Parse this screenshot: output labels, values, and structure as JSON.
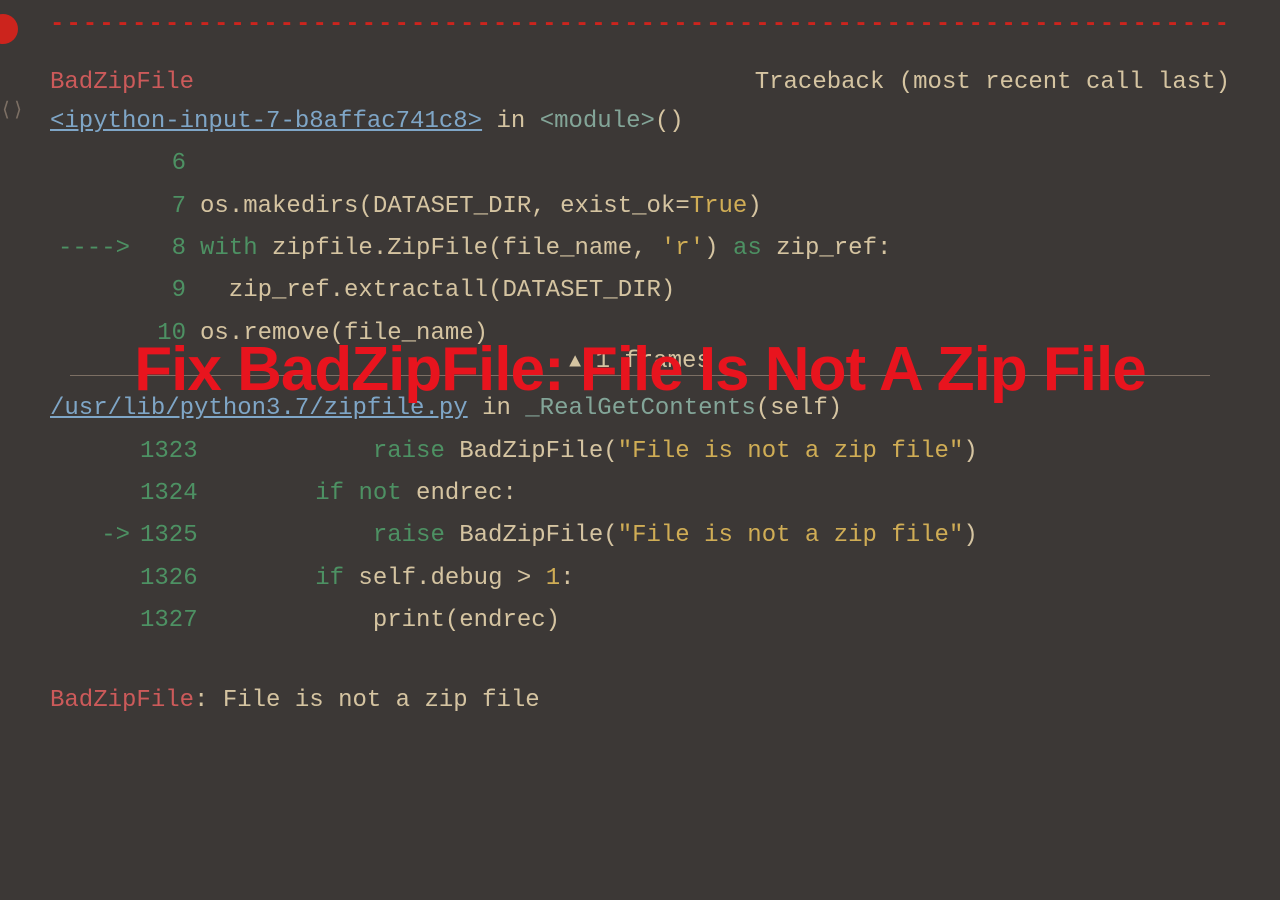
{
  "separator": "-------------------------------------------------------------------------------",
  "header": {
    "error_name": "BadZipFile",
    "traceback_label": "Traceback (most recent call last)"
  },
  "frame1": {
    "link": "<ipython-input-7-b8affac741c8>",
    "suffix_in": " in ",
    "suffix_mod": "<module>",
    "suffix_paren": "()",
    "arrow": "---->",
    "lines": [
      {
        "num": "6",
        "arrow": "",
        "code": ""
      },
      {
        "num": "7",
        "arrow": "",
        "parts": [
          {
            "t": "os",
            "c": "kw-var"
          },
          {
            "t": ".",
            "c": "punct"
          },
          {
            "t": "makedirs",
            "c": "kw-var"
          },
          {
            "t": "(",
            "c": "punct"
          },
          {
            "t": "DATASET_DIR",
            "c": "kw-var"
          },
          {
            "t": ",",
            "c": "comma"
          },
          {
            "t": " exist_ok",
            "c": "kw-var"
          },
          {
            "t": "=",
            "c": "punct"
          },
          {
            "t": "True",
            "c": "kw-true"
          },
          {
            "t": ")",
            "c": "punct"
          }
        ]
      },
      {
        "num": "8",
        "arrow": "---->",
        "parts": [
          {
            "t": "with",
            "c": "kw-with"
          },
          {
            "t": " zipfile",
            "c": "kw-var"
          },
          {
            "t": ".",
            "c": "punct"
          },
          {
            "t": "ZipFile",
            "c": "kw-var"
          },
          {
            "t": "(",
            "c": "punct"
          },
          {
            "t": "file_name",
            "c": "kw-var"
          },
          {
            "t": ",",
            "c": "comma"
          },
          {
            "t": " ",
            "c": "punct"
          },
          {
            "t": "'r'",
            "c": "str"
          },
          {
            "t": ")",
            "c": "punct"
          },
          {
            "t": " ",
            "c": "punct"
          },
          {
            "t": "as",
            "c": "kw-as"
          },
          {
            "t": " zip_ref",
            "c": "kw-var"
          },
          {
            "t": ":",
            "c": "punct"
          }
        ]
      },
      {
        "num": "9",
        "arrow": "",
        "parts": [
          {
            "t": "  zip_ref",
            "c": "kw-var"
          },
          {
            "t": ".",
            "c": "punct"
          },
          {
            "t": "extractall",
            "c": "kw-var"
          },
          {
            "t": "(",
            "c": "punct"
          },
          {
            "t": "DATASET_DIR",
            "c": "kw-var"
          },
          {
            "t": ")",
            "c": "punct"
          }
        ]
      },
      {
        "num": "10",
        "arrow": "",
        "parts": [
          {
            "t": "os",
            "c": "kw-var"
          },
          {
            "t": ".",
            "c": "punct"
          },
          {
            "t": "remove",
            "c": "kw-var"
          },
          {
            "t": "(",
            "c": "punct"
          },
          {
            "t": "file_name",
            "c": "kw-var"
          },
          {
            "t": ")",
            "c": "punct"
          }
        ]
      }
    ]
  },
  "frames_label": "1 frames",
  "frame2": {
    "link": "/usr/lib/python3.7/zipfile.py",
    "suffix_in": " in ",
    "suffix_fn": "_RealGetContents",
    "suffix_args": "(self)",
    "lines": [
      {
        "num": "1323",
        "arrow": "",
        "parts": [
          {
            "t": "            ",
            "c": "punct"
          },
          {
            "t": "raise",
            "c": "kw-with"
          },
          {
            "t": " BadZipFile",
            "c": "kw-var"
          },
          {
            "t": "(",
            "c": "punct"
          },
          {
            "t": "\"File is not a zip file\"",
            "c": "str"
          },
          {
            "t": ")",
            "c": "punct"
          }
        ]
      },
      {
        "num": "1324",
        "arrow": "",
        "parts": [
          {
            "t": "        ",
            "c": "punct"
          },
          {
            "t": "if",
            "c": "kw-if"
          },
          {
            "t": " ",
            "c": "punct"
          },
          {
            "t": "not",
            "c": "kw-if"
          },
          {
            "t": " endrec",
            "c": "kw-var"
          },
          {
            "t": ":",
            "c": "punct"
          }
        ]
      },
      {
        "num": "1325",
        "arrow": "->",
        "parts": [
          {
            "t": "            ",
            "c": "punct"
          },
          {
            "t": "raise",
            "c": "kw-with"
          },
          {
            "t": " BadZipFile",
            "c": "kw-var"
          },
          {
            "t": "(",
            "c": "punct"
          },
          {
            "t": "\"File is not a zip file\"",
            "c": "str"
          },
          {
            "t": ")",
            "c": "punct"
          }
        ]
      },
      {
        "num": "1326",
        "arrow": "",
        "parts": [
          {
            "t": "        ",
            "c": "punct"
          },
          {
            "t": "if",
            "c": "kw-if"
          },
          {
            "t": " self",
            "c": "kw-var"
          },
          {
            "t": ".",
            "c": "punct"
          },
          {
            "t": "debug ",
            "c": "kw-var"
          },
          {
            "t": ">",
            "c": "punct"
          },
          {
            "t": " ",
            "c": "punct"
          },
          {
            "t": "1",
            "c": "kw-true"
          },
          {
            "t": ":",
            "c": "punct"
          }
        ]
      },
      {
        "num": "1327",
        "arrow": "",
        "parts": [
          {
            "t": "            print",
            "c": "kw-var"
          },
          {
            "t": "(",
            "c": "punct"
          },
          {
            "t": "endrec",
            "c": "kw-var"
          },
          {
            "t": ")",
            "c": "punct"
          }
        ]
      }
    ]
  },
  "final": {
    "name": "BadZipFile",
    "colon": ": ",
    "msg": "File is not a zip file"
  },
  "overlay": "Fix BadZipFile: File Is Not A Zip File"
}
